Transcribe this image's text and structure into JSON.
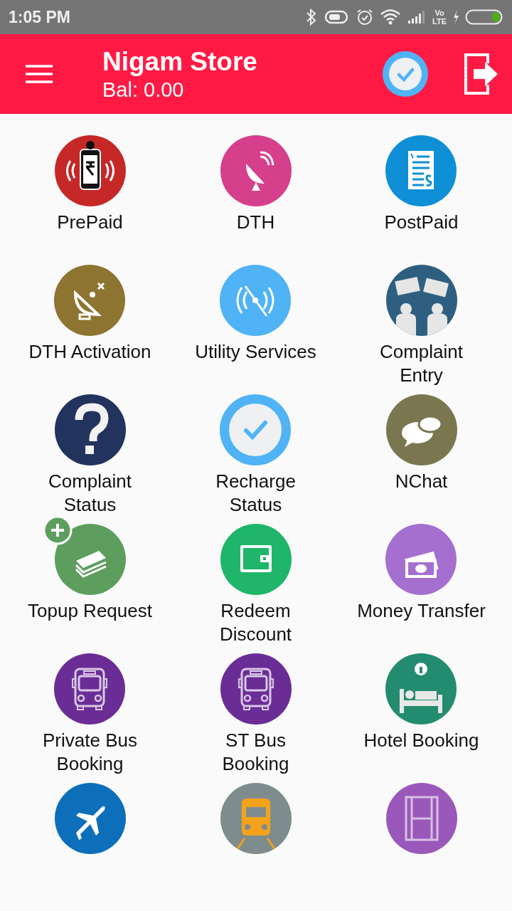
{
  "status_bar": {
    "time": "1:05 PM",
    "volte_top": "Vo",
    "volte_bottom": "LTE"
  },
  "header": {
    "title": "Nigam Store",
    "balance": "Bal: 0.00"
  },
  "services": [
    {
      "kind": "labeled",
      "label": "PrePaid"
    },
    {
      "kind": "labeled",
      "label": "DTH"
    },
    {
      "kind": "labeled",
      "label": "PostPaid"
    },
    {
      "kind": "labeled",
      "label": "DTH Activation"
    },
    {
      "kind": "labeled",
      "label": "Utility Services"
    },
    {
      "kind": "labeled",
      "label": "Complaint\nEntry"
    },
    {
      "kind": "labeled",
      "label": "Complaint\nStatus"
    },
    {
      "kind": "labeled",
      "label": "Recharge\nStatus"
    },
    {
      "kind": "labeled",
      "label": "NChat"
    },
    {
      "kind": "labeled",
      "label": "Topup Request"
    },
    {
      "kind": "labeled",
      "label": "Redeem\nDiscount"
    },
    {
      "kind": "labeled",
      "label": "Money Transfer"
    },
    {
      "kind": "labeled",
      "label": "Private Bus\nBooking"
    },
    {
      "kind": "labeled",
      "label": "ST Bus\nBooking"
    },
    {
      "kind": "labeled",
      "label": "Hotel Booking"
    },
    {
      "kind": "icon_only"
    },
    {
      "kind": "icon_only"
    },
    {
      "kind": "icon_only"
    }
  ]
}
